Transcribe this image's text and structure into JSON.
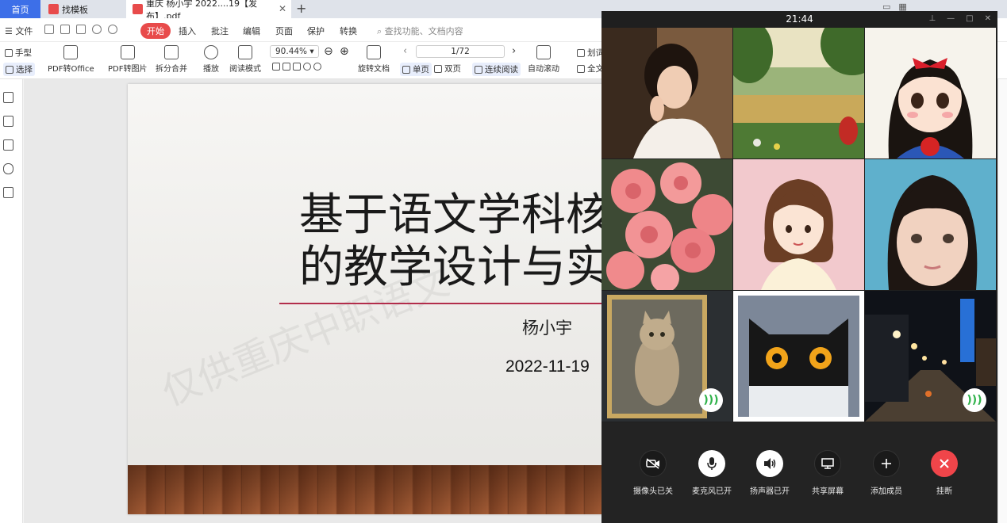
{
  "tabs": {
    "home": "首页",
    "template": "找模板",
    "document": "重庆 杨小宇 2022....19【发布】.pdf"
  },
  "menu": {
    "file": "文件",
    "items": [
      "开始",
      "插入",
      "批注",
      "编辑",
      "页面",
      "保护",
      "转换"
    ],
    "search_placeholder": "查找功能、文档内容"
  },
  "ribbon": {
    "hand": "手型",
    "select": "选择",
    "pdf_to_office": "PDF转Office",
    "pdf_to_image": "PDF转图片",
    "split_merge": "拆分合并",
    "play": "播放",
    "read_mode": "阅读模式",
    "zoom": "90.44%",
    "rotate_doc": "旋转文档",
    "page": "1/72",
    "single_page": "单页",
    "double_page": "双页",
    "continuous": "连续阅读",
    "auto_scroll": "自动滚动",
    "trans_partial": "划词",
    "full_text": "全文"
  },
  "slide": {
    "title_line1": "基于语文学科核",
    "title_line2": "的教学设计与实",
    "author": "杨小宇",
    "date": "2022-11-19",
    "watermark": "仅供重庆中职语文"
  },
  "call": {
    "time": "21:44",
    "buttons": {
      "camera": "摄像头已关",
      "mic": "麦克风已开",
      "speaker": "扬声器已开",
      "share": "共享屏幕",
      "add": "添加成员",
      "hangup": "挂断"
    }
  },
  "colors": {
    "accent_blue": "#3d6fe8",
    "wps_red": "#e84b4b",
    "slide_line": "#b22d4b",
    "call_bg": "#1f1f1f",
    "hangup_red": "#f0454a",
    "speaking_green": "#2fb24a"
  }
}
